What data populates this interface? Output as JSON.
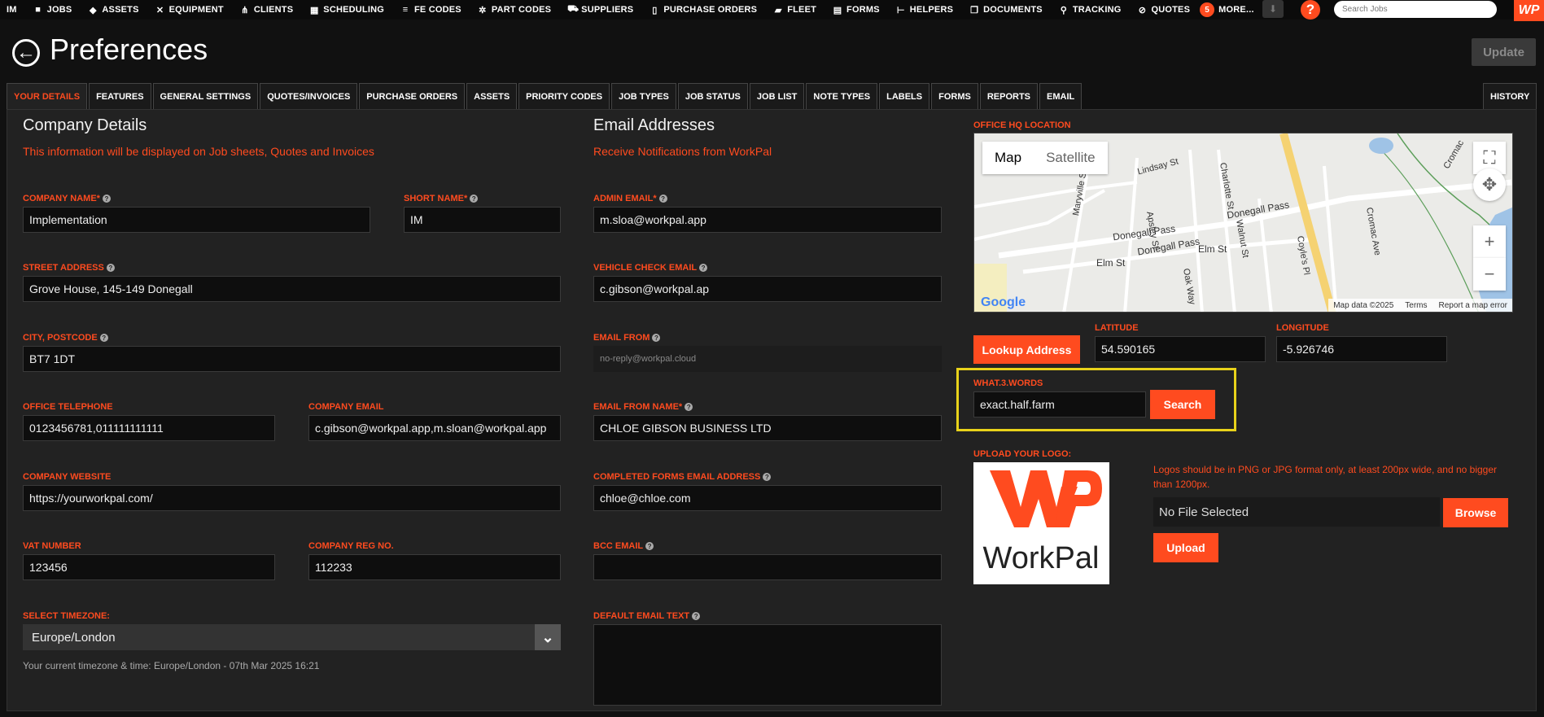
{
  "nav": {
    "items": [
      {
        "label": "IM",
        "icon": ""
      },
      {
        "label": "JOBS",
        "icon": "briefcase-icon"
      },
      {
        "label": "ASSETS",
        "icon": "cube-icon"
      },
      {
        "label": "EQUIPMENT",
        "icon": "tools-icon"
      },
      {
        "label": "CLIENTS",
        "icon": "sitemap-icon"
      },
      {
        "label": "SCHEDULING",
        "icon": "calendar-icon"
      },
      {
        "label": "FE CODES",
        "icon": "list-icon"
      },
      {
        "label": "PART CODES",
        "icon": "cogs-icon"
      },
      {
        "label": "SUPPLIERS",
        "icon": "cart-icon"
      },
      {
        "label": "PURCHASE ORDERS",
        "icon": "document-icon"
      },
      {
        "label": "FLEET",
        "icon": "truck-icon"
      },
      {
        "label": "FORMS",
        "icon": "clipboard-icon"
      },
      {
        "label": "HELPERS",
        "icon": "hierarchy-icon"
      },
      {
        "label": "DOCUMENTS",
        "icon": "documents-icon"
      },
      {
        "label": "TRACKING",
        "icon": "map-pin-icon"
      },
      {
        "label": "QUOTES",
        "icon": "paperclip-icon"
      }
    ],
    "more_badge": "5",
    "more_label": "MORE...",
    "search_placeholder": "Search Jobs",
    "help": "?",
    "logo_text": "WP"
  },
  "header": {
    "title": "Preferences",
    "update_label": "Update"
  },
  "tabs": [
    "YOUR DETAILS",
    "FEATURES",
    "GENERAL SETTINGS",
    "QUOTES/INVOICES",
    "PURCHASE ORDERS",
    "ASSETS",
    "PRIORITY CODES",
    "JOB TYPES",
    "JOB STATUS",
    "JOB LIST",
    "NOTE TYPES",
    "LABELS",
    "FORMS",
    "REPORTS",
    "EMAIL"
  ],
  "history_tab": "HISTORY",
  "company": {
    "title": "Company Details",
    "subtitle": "This information will be displayed on Job sheets, Quotes and Invoices",
    "company_name_label": "COMPANY NAME*",
    "company_name": "Implementation",
    "short_name_label": "SHORT NAME*",
    "short_name": "IM",
    "street_label": "STREET ADDRESS",
    "street": "Grove House, 145-149 Donegall",
    "city_label": "CITY, POSTCODE",
    "city": "BT7 1DT",
    "phone_label": "OFFICE TELEPHONE",
    "phone": "0123456781,011111111111",
    "email_label": "COMPANY EMAIL",
    "email": "c.gibson@workpal.app,m.sloan@workpal.app",
    "website_label": "COMPANY WEBSITE",
    "website": "https://yourworkpal.com/",
    "vat_label": "VAT NUMBER",
    "vat": "123456",
    "reg_label": "COMPANY REG NO.",
    "reg": "112233",
    "timezone_label": "SELECT TIMEZONE:",
    "timezone": "Europe/London",
    "timezone_info": "Your current timezone & time: Europe/London - 07th Mar 2025 16:21"
  },
  "emails": {
    "title": "Email Addresses",
    "subtitle": "Receive Notifications from WorkPal",
    "admin_label": "ADMIN EMAIL*",
    "admin": "m.sloa@workpal.app",
    "vehicle_label": "VEHICLE CHECK EMAIL",
    "vehicle": "c.gibson@workpal.ap",
    "from_label": "EMAIL FROM",
    "from": "no-reply@workpal.cloud",
    "from_name_label": "EMAIL FROM NAME*",
    "from_name": "CHLOE GIBSON BUSINESS LTD",
    "forms_label": "COMPLETED FORMS EMAIL ADDRESS",
    "forms": "chloe@chloe.com",
    "bcc_label": "BCC EMAIL",
    "bcc": "",
    "default_text_label": "DEFAULT EMAIL TEXT"
  },
  "location": {
    "label": "OFFICE HQ LOCATION",
    "map_tab": "Map",
    "satellite_tab": "Satellite",
    "map_data": "Map data ©2025",
    "terms": "Terms",
    "report": "Report a map error",
    "google": "Google",
    "streets": [
      "Donegall Pass",
      "Donegall Pass",
      "Donegall Pass",
      "Elm St",
      "Elm St",
      "Lindsay St",
      "Maryville St",
      "Apsley St",
      "Charlotte St",
      "Walnut St",
      "Oak Way",
      "Cromac Ave",
      "Coyle's Pl",
      "Cromac"
    ],
    "lookup_label": "Lookup Address",
    "lat_label": "LATITUDE",
    "lat": "54.590165",
    "lng_label": "LONGITUDE",
    "lng": "-5.926746",
    "w3w_label": "WHAT.3.WORDS",
    "w3w": "exact.half.farm",
    "search_label": "Search"
  },
  "logo": {
    "label": "UPLOAD YOUR LOGO:",
    "note": "Logos should be in PNG or JPG format only, at least 200px wide, and no bigger than 1200px.",
    "file": "No File Selected",
    "browse": "Browse",
    "upload": "Upload",
    "logo_word": "WorkPal"
  },
  "colors": {
    "accent": "#ff4b1f",
    "highlight": "#e8d21a"
  }
}
